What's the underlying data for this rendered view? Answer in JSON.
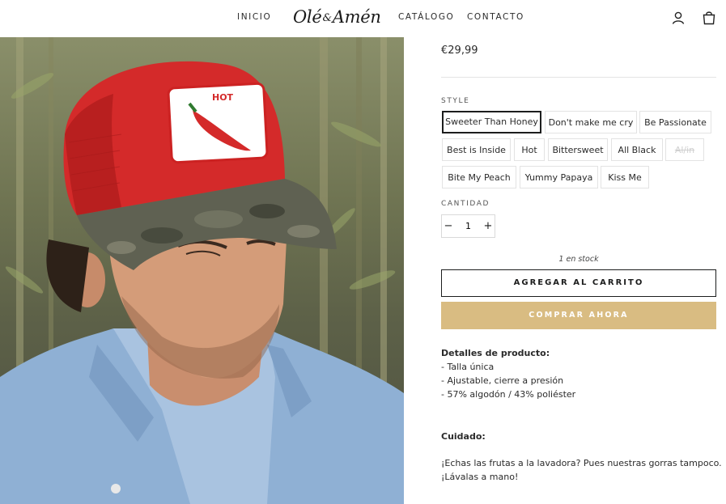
{
  "header": {
    "nav": [
      "INICIO",
      "CATÁLOGO",
      "CONTACTO"
    ],
    "logo_left": "Olé",
    "logo_amp": "&",
    "logo_right": "Amén",
    "icons": [
      "user-icon",
      "cart-icon"
    ]
  },
  "product": {
    "price": "€29,99",
    "style_label": "STYLE",
    "styles": [
      "Sweeter Than Honey",
      "Don't make me cry",
      "Be Passionate",
      "Best is Inside",
      "Hot",
      "Bittersweet",
      "All Black",
      "Al/in",
      "Bite My Peach",
      "Yummy Papaya",
      "Kiss Me"
    ],
    "selected_style": "Sweeter Than Honey",
    "qty_label": "CANTIDAD",
    "qty_minus": "−",
    "qty_plus": "+",
    "qty_value": "1",
    "stock": "1 en stock",
    "add_to_cart": "AGREGAR AL CARRITO",
    "buy_now": "COMPRAR AHORA",
    "cap_patch_text": "HOT"
  },
  "details": {
    "title": "Detalles de producto:",
    "lines": [
      "- Talla única",
      "- Ajustable, cierre a presión",
      "- 57% algodón / 43% poliéster"
    ],
    "care_title": "Cuidado:",
    "care_lines": [
      "¡Echas las frutas a la lavadora? Pues nuestras gorras tampoco.",
      "¡Lávalas a mano!"
    ]
  },
  "colors": {
    "accent": "#d9bc82",
    "text": "#1c1d1d",
    "cap_red": "#d42a2a"
  }
}
